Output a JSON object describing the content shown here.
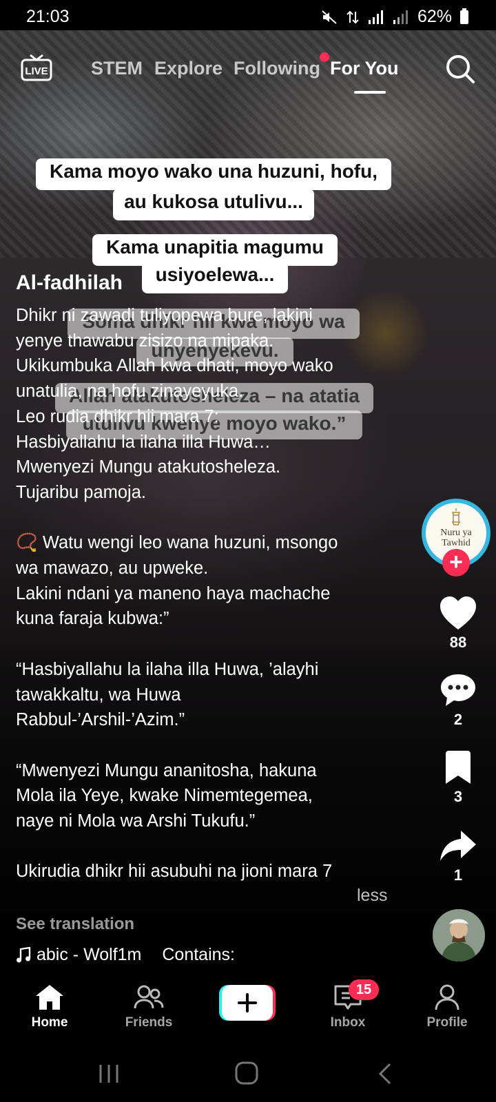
{
  "status_bar": {
    "time": "21:03",
    "battery": "62%"
  },
  "top_nav": {
    "live_label": "LIVE",
    "tabs": [
      {
        "label": "STEM"
      },
      {
        "label": "Explore"
      },
      {
        "label": "Following"
      },
      {
        "label": "For You"
      }
    ],
    "active_tab": "For You"
  },
  "video_captions": [
    "Kama moyo wako una huzuni, hofu,",
    "au kukosa utulivu...",
    "Kama unapitia magumu",
    "usiyoelewa...",
    "Soma dhikr hii kwa moyo wa",
    "unyenyekevu.",
    "Allah atakutosheleza – na atatia",
    "utulivu kwenye moyo wako.”"
  ],
  "post": {
    "author": "Al-fadhilah",
    "description": "Dhikr ni zawadi tuliyopewa bure, lakini\nyenye thawabu zisizo na mipaka.\nUkikumbuka Allah kwa dhati, moyo wako\nunatulia, na hofu zinayeyuka.\nLeo rudia dhikr hii mara 7:\nHasbiyallahu la ilaha illa Huwa…\nMwenyezi Mungu atakutosheleza.\nTujaribu pamoja.\n\n📿 Watu wengi leo wana huzuni, msongo\nwa mawazo, au upweke.\nLakini ndani ya maneno haya machache\nkuna faraja kubwa:”\n\n“Hasbiyallahu la ilaha illa Huwa, ’alayhi\ntawakkaltu, wa Huwa\nRabbul-’Arshil-’Azim.”\n\n“Mwenyezi Mungu ananitosha, hakuna\nMola ila Yeye, kwake Nimemtegemea,\nnaye ni Mola wa Arshi Tukufu.”\n\nUkirudia dhikr hii asubuhi na jioni mara 7",
    "less_label": "less",
    "see_translation": "See translation",
    "music": "abic - Wolf1m",
    "contains": "Contains:"
  },
  "creator_avatar": {
    "line1": "Nuru ya",
    "line2": "Tawhid"
  },
  "actions": {
    "likes": "88",
    "comments": "2",
    "bookmarks": "3",
    "shares": "1"
  },
  "bottom_nav": {
    "home": "Home",
    "friends": "Friends",
    "inbox": "Inbox",
    "inbox_badge": "15",
    "profile": "Profile"
  },
  "colors": {
    "accent": "#fe2c55",
    "avatar_ring": "#35b8e0",
    "create_cyan": "#25f4ee"
  }
}
